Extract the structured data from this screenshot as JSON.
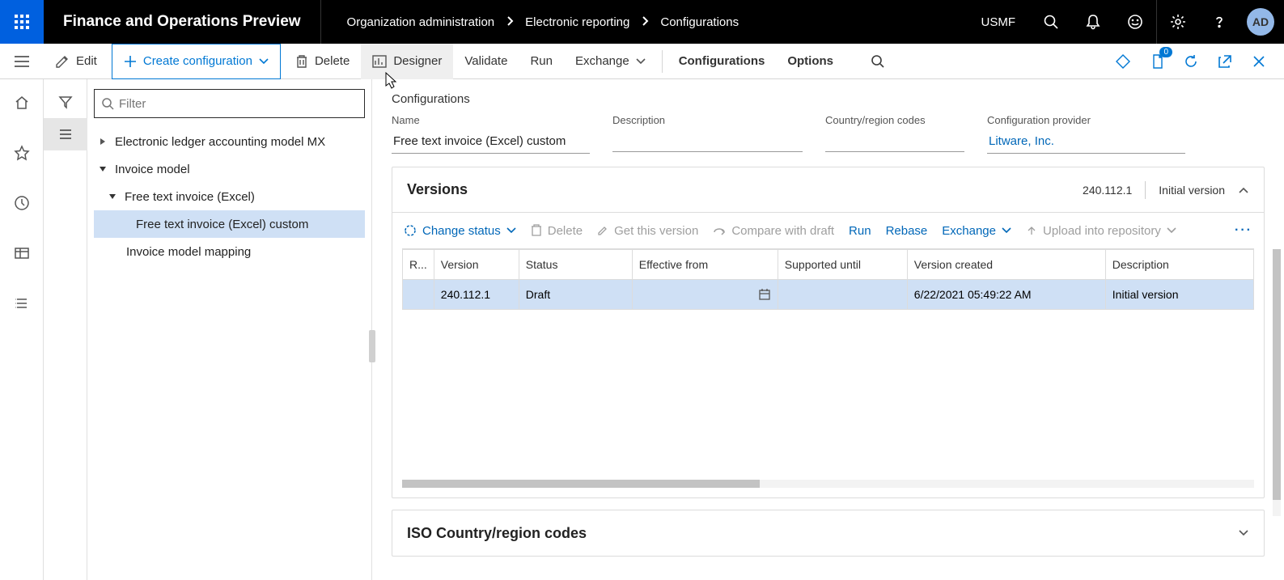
{
  "header": {
    "app_title": "Finance and Operations Preview",
    "breadcrumbs": [
      "Organization administration",
      "Electronic reporting",
      "Configurations"
    ],
    "company": "USMF",
    "avatar": "AD",
    "notification_count": "0"
  },
  "actionbar": {
    "edit": "Edit",
    "create_config": "Create configuration",
    "delete": "Delete",
    "designer": "Designer",
    "validate": "Validate",
    "run": "Run",
    "exchange": "Exchange",
    "configurations": "Configurations",
    "options": "Options"
  },
  "tree": {
    "filter_placeholder": "Filter",
    "nodes": {
      "n0": "Electronic ledger accounting model MX",
      "n1": "Invoice model",
      "n2": "Free text invoice (Excel)",
      "n3": "Free text invoice (Excel) custom",
      "n4": "Invoice model mapping"
    }
  },
  "detail": {
    "section": "Configurations",
    "fields": {
      "name_label": "Name",
      "name_value": "Free text invoice (Excel) custom",
      "desc_label": "Description",
      "desc_value": "",
      "ctry_label": "Country/region codes",
      "ctry_value": "",
      "prov_label": "Configuration provider",
      "prov_value": "Litware, Inc."
    }
  },
  "versions": {
    "title": "Versions",
    "summary_version": "240.112.1",
    "summary_desc": "Initial version",
    "toolbar": {
      "change_status": "Change status",
      "delete": "Delete",
      "get_version": "Get this version",
      "compare": "Compare with draft",
      "run": "Run",
      "rebase": "Rebase",
      "exchange": "Exchange",
      "upload": "Upload into repository"
    },
    "columns": {
      "r": "R...",
      "version": "Version",
      "status": "Status",
      "eff_from": "Effective from",
      "supp_until": "Supported until",
      "created": "Version created",
      "desc": "Description"
    },
    "rows": [
      {
        "version": "240.112.1",
        "status": "Draft",
        "eff_from": "",
        "supp_until": "",
        "created": "6/22/2021 05:49:22 AM",
        "desc": "Initial version"
      }
    ]
  },
  "iso": {
    "title": "ISO Country/region codes"
  }
}
